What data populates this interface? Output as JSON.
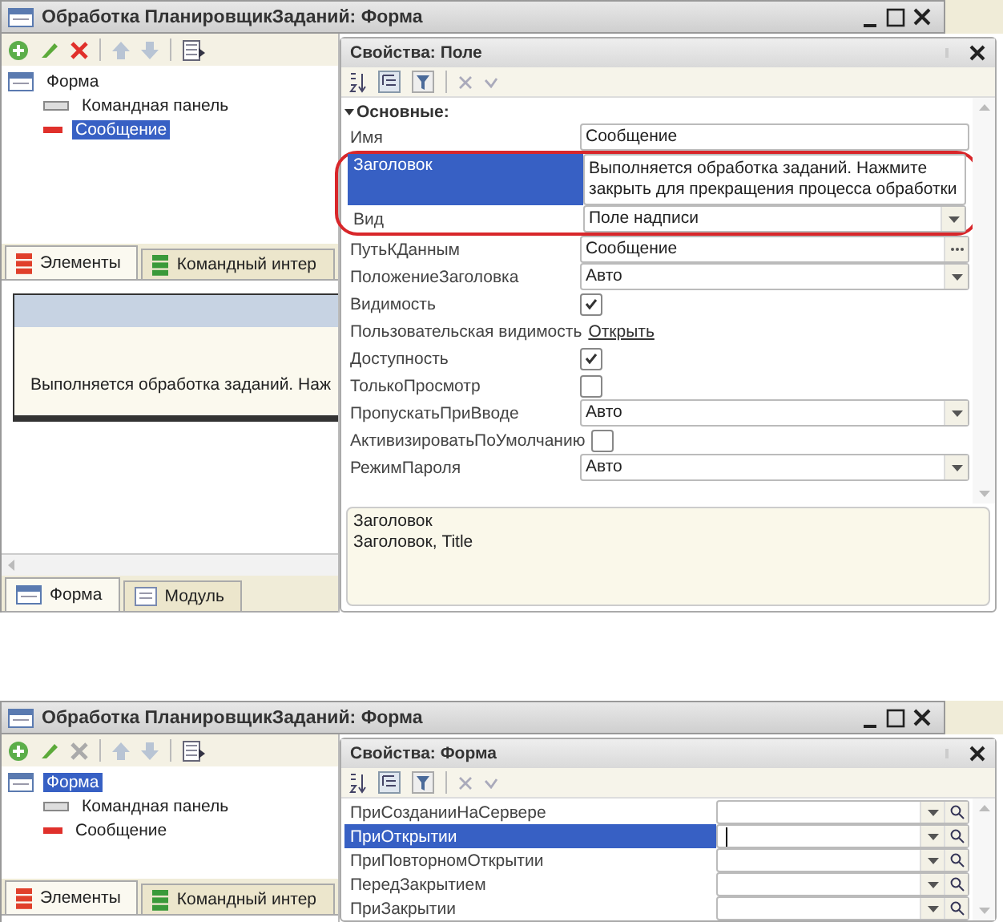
{
  "windows": [
    {
      "title": "Обработка ПланировщикЗаданий: Форма",
      "tree": [
        {
          "label": "Форма",
          "selected": false,
          "children": [
            {
              "label": "Командная панель",
              "selected": false
            },
            {
              "label": "Сообщение",
              "selected": true
            }
          ]
        }
      ],
      "tabs": [
        {
          "label": "Элементы",
          "selected": true
        },
        {
          "label": "Командный интер",
          "selected": false
        }
      ],
      "preview": {
        "text": "Выполняется обработка заданий. Наж"
      },
      "bottom_tabs": [
        {
          "label": "Форма",
          "selected": true
        },
        {
          "label": "Модуль",
          "selected": false
        }
      ],
      "properties": {
        "title": "Свойства: Поле",
        "group": {
          "label": "Основные:",
          "expanded": true
        },
        "rows": [
          {
            "kind": "text",
            "label": "Имя",
            "value": "Сообщение",
            "selected": false
          },
          {
            "kind": "circled",
            "rows": [
              {
                "kind": "multiline",
                "label": "Заголовок",
                "value": "Выполняется обработка заданий. Нажмите закрыть для прекращения процесса обработки",
                "selected": true
              },
              {
                "kind": "select",
                "label": "Вид",
                "value": "Поле надписи",
                "selected": false
              }
            ]
          },
          {
            "kind": "dots",
            "label": "ПутьКДанным",
            "value": "Сообщение",
            "selected": false
          },
          {
            "kind": "select",
            "label": "ПоложениеЗаголовка",
            "value": "Авто",
            "selected": false
          },
          {
            "kind": "checkbox",
            "label": "Видимость",
            "checked": true,
            "selected": false
          },
          {
            "kind": "link",
            "label": "Пользовательская видимость",
            "value": "Открыть",
            "selected": false
          },
          {
            "kind": "checkbox",
            "label": "Доступность",
            "checked": true,
            "selected": false
          },
          {
            "kind": "checkbox",
            "label": "ТолькоПросмотр",
            "checked": false,
            "selected": false
          },
          {
            "kind": "select",
            "label": "ПропускатьПриВводе",
            "value": "Авто",
            "selected": false
          },
          {
            "kind": "checkbox",
            "label": "АктивизироватьПоУмолчанию",
            "checked": false,
            "selected": false
          },
          {
            "kind": "select",
            "label": "РежимПароля",
            "value": "Авто",
            "selected": false
          }
        ],
        "description": [
          "Заголовок",
          "Заголовок, Title"
        ]
      }
    },
    {
      "title": "Обработка ПланировщикЗаданий: Форма",
      "tree": [
        {
          "label": "Форма",
          "selected": true,
          "children": [
            {
              "label": "Командная панель",
              "selected": false
            },
            {
              "label": "Сообщение",
              "selected": false
            }
          ]
        }
      ],
      "tabs": [
        {
          "label": "Элементы",
          "selected": true
        },
        {
          "label": "Командный интер",
          "selected": false
        }
      ],
      "properties": {
        "title": "Свойства: Форма",
        "rows": [
          {
            "kind": "event",
            "label": "ПриСозданииНаСервере",
            "selected": false
          },
          {
            "kind": "event",
            "label": "ПриОткрытии",
            "selected": true
          },
          {
            "kind": "event",
            "label": "ПриПовторномОткрытии",
            "selected": false
          },
          {
            "kind": "event",
            "label": "ПередЗакрытием",
            "selected": false
          },
          {
            "kind": "event",
            "label": "ПриЗакрытии",
            "selected": false
          }
        ]
      }
    }
  ]
}
